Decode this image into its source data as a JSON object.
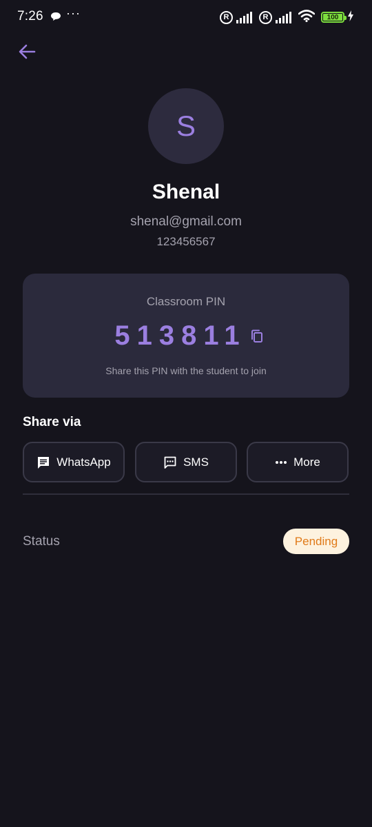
{
  "status_bar": {
    "time": "7:26",
    "more_dots": "···",
    "reg_mark_1": "R",
    "reg_mark_2": "R",
    "battery": "100"
  },
  "profile": {
    "initial": "S",
    "name": "Shenal",
    "email": "shenal@gmail.com",
    "phone": "123456567"
  },
  "pin_card": {
    "label": "Classroom PIN",
    "pin": "513811",
    "hint": "Share this PIN with the student to join"
  },
  "share": {
    "title": "Share via",
    "buttons": [
      {
        "label": "WhatsApp",
        "icon": "chat-icon"
      },
      {
        "label": "SMS",
        "icon": "sms-icon"
      },
      {
        "label": "More",
        "icon": "more-horiz-icon"
      }
    ]
  },
  "status": {
    "label": "Status",
    "value": "Pending",
    "badge_bg": "#fdf2df",
    "badge_color": "#e07a19"
  },
  "colors": {
    "background": "#15141c",
    "card": "#2b2a3c",
    "accent": "#9b7fe0",
    "muted_text": "#a4a2ae"
  }
}
